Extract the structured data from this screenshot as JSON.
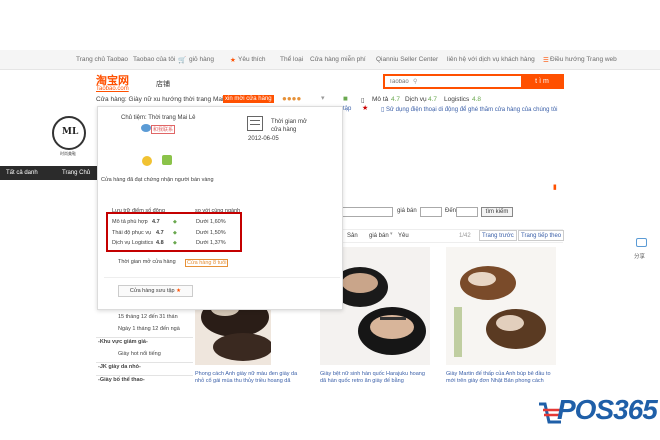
{
  "topnav": {
    "items": [
      "Trang chủ Taobao",
      "Taobao của tôi",
      "giỏ hàng",
      "Yêu thích",
      "Thể loại",
      "Cửa hàng miễn phí",
      "Qianniu Seller Center",
      "liên hệ với dịch vụ khách hàng",
      "Điều hướng Trang web"
    ]
  },
  "header": {
    "logo_cn": "淘宝网",
    "logo_en": "Taobao.com",
    "store_label": "店铺",
    "search_placeholder": "Taobao",
    "search_button": "tìm"
  },
  "shopbar": {
    "shop_name": "Cửa hàng: Giày nữ xu hướng thời trang Mai Lê",
    "follow": "xin mời cửa hàng",
    "desc_label": "Mô tả",
    "desc_score": "4.7",
    "service_label": "Dịch vụ",
    "service_score": "4.7",
    "logistics_label": "Logistics",
    "logistics_score": "4.8",
    "notice": "Sử dụng điện thoại di động để ghé thăm cửa hàng của chúng tôi"
  },
  "popup": {
    "badge_text": "ML",
    "badge_sub": "时尚美鞋",
    "owner": "Chủ tiệm: Thời trang Mai Lê",
    "contact": "和我联系",
    "open_label": "Thời gian mở cửa hàng",
    "open_date": "2012-06-05",
    "certified": "Cửa hàng đã đạt chứng nhận người bán vàng",
    "score_title": "Lưu trữ điểm số động",
    "compare_title": "so với cùng ngành",
    "rows": [
      {
        "label": "Mô tả phù hợp",
        "score": "4.7",
        "trend": "Dưới 1,60%"
      },
      {
        "label": "Thái độ phục vụ",
        "score": "4.7",
        "trend": "Dưới 1,50%"
      },
      {
        "label": "Dịch vụ Logistics",
        "score": "4.8",
        "trend": "Dưới 1,37%"
      }
    ],
    "open_time_label": "Thời gian mở cửa hàng",
    "open_time_value": "Cửa hàng 8 tuổi",
    "fav_button": "Cửa hàng sưu tập"
  },
  "catbar": {
    "all": "Tất cả danh",
    "home": "Trang Chủ"
  },
  "filters": {
    "price_label": "giá bán",
    "to_label": "Đến",
    "search_btn": "tìm kiếm",
    "sort_items": [
      "Sản",
      "giá bán",
      "Yêu"
    ],
    "page_info": "1/42",
    "prev": "Trang trước",
    "next": "Trang tiếp theo"
  },
  "sidebar": {
    "items": [
      "15 tháng 12 đến 31 thán",
      "Ngày 1 tháng 12 đến ngà",
      "-Khu vực giảm giá-",
      "Giày hot nổi tiếng",
      "-JK giày da nhỏ-",
      "-Giày bố thể thao-"
    ]
  },
  "products": [
    {
      "caption": "Phong cách Anh giày nữ màu đen giày da nhỏ cổ gái mùa thu thủy triều hoang dã"
    },
    {
      "caption": "Giày bệt nữ sinh hàn quốc Harajuku hoang dã hàn quốc retro ăn giày đế bằng"
    },
    {
      "caption": "Giày Martin đế thấp của Anh búp bê đầu to mới trên giày đơn Nhật Bản phong cách"
    }
  ],
  "share_label": "分享",
  "watermark": "POS365"
}
